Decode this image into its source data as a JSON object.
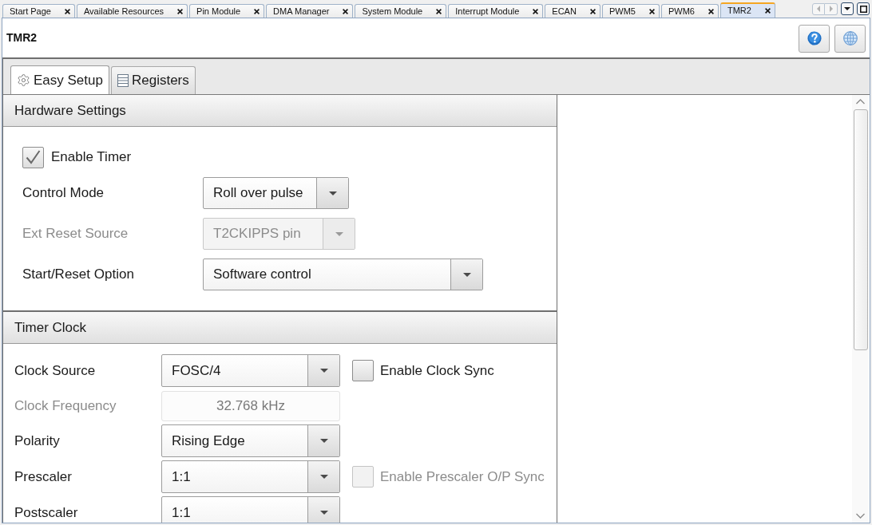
{
  "editor_tabs": [
    {
      "label": "Start Page",
      "selected": false
    },
    {
      "label": "Available Resources",
      "selected": false
    },
    {
      "label": "Pin Module",
      "selected": false
    },
    {
      "label": "DMA Manager",
      "selected": false
    },
    {
      "label": "System Module",
      "selected": false
    },
    {
      "label": "Interrupt Module",
      "selected": false
    },
    {
      "label": "ECAN",
      "selected": false
    },
    {
      "label": "PWM5",
      "selected": false
    },
    {
      "label": "PWM6",
      "selected": false
    },
    {
      "label": "TMR2",
      "selected": true
    }
  ],
  "title": "TMR2",
  "view_tabs": [
    {
      "label": "Easy Setup",
      "selected": true
    },
    {
      "label": "Registers",
      "selected": false
    }
  ],
  "sections": [
    {
      "title": "Hardware Settings",
      "rows": [
        {
          "kind": "checkbox",
          "label": "Enable Timer",
          "checked": true,
          "disabled": false
        },
        {
          "kind": "dropdown",
          "label": "Control Mode",
          "value": "Roll over pulse",
          "disabled": false
        },
        {
          "kind": "dropdown",
          "label": "Ext Reset Source",
          "value": "T2CKIPPS pin",
          "disabled": true
        },
        {
          "kind": "dropdown",
          "label": "Start/Reset Option",
          "value": "Software control",
          "disabled": false
        }
      ]
    },
    {
      "title": "Timer Clock",
      "rows": [
        {
          "kind": "dropdown",
          "label": "Clock Source",
          "value": "FOSC/4",
          "disabled": false,
          "option": {
            "label": "Enable Clock Sync",
            "checked": false,
            "disabled": false
          }
        },
        {
          "kind": "readout",
          "label": "Clock Frequency",
          "value": "32.768 kHz",
          "disabled": true
        },
        {
          "kind": "dropdown",
          "label": "Polarity",
          "value": "Rising Edge",
          "disabled": false
        },
        {
          "kind": "dropdown",
          "label": "Prescaler",
          "value": "1:1",
          "disabled": false,
          "option": {
            "label": "Enable Prescaler O/P Sync",
            "checked": false,
            "disabled": true
          }
        },
        {
          "kind": "dropdown",
          "label": "Postscaler",
          "value": "1:1",
          "disabled": false
        }
      ]
    }
  ]
}
